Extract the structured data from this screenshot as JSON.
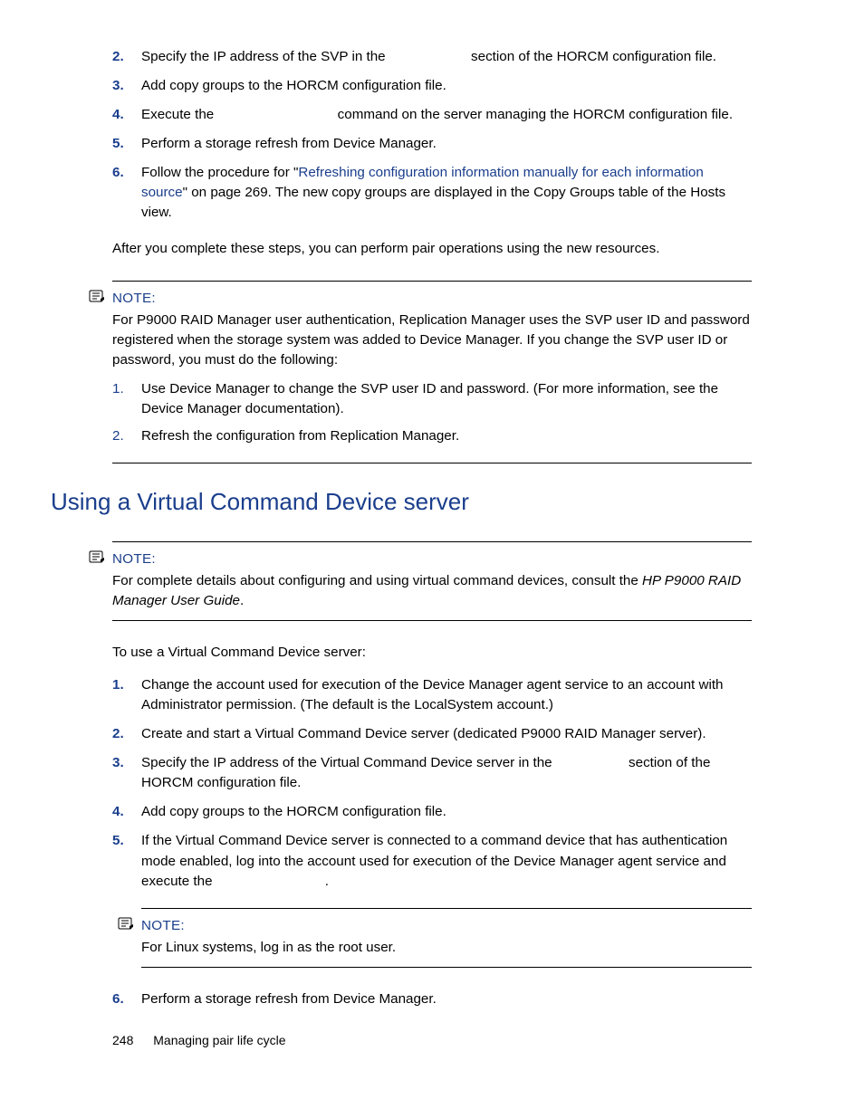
{
  "steps_top": [
    {
      "n": "2.",
      "text_before": "Specify the IP address of the SVP in the ",
      "code": "",
      "text_after": " section of the HORCM configuration file."
    },
    {
      "n": "3.",
      "text": "Add copy groups to the HORCM configuration file."
    },
    {
      "n": "4.",
      "text_before": "Execute the ",
      "code": "",
      "text_after": " command on the server managing the HORCM configuration file."
    },
    {
      "n": "5.",
      "text": "Perform a storage refresh from Device Manager."
    },
    {
      "n": "6.",
      "text_before": "Follow the procedure for \"",
      "link": "Refreshing configuration information manually for each information source",
      "text_after": "\" on page 269. The new copy groups are displayed in the Copy Groups table of the Hosts view."
    }
  ],
  "after_steps": "After you complete these steps, you can perform pair operations using the new resources.",
  "note1": {
    "label": "NOTE:",
    "text": "For P9000 RAID Manager user authentication, Replication Manager uses the SVP user ID and password registered when the storage system was added to Device Manager. If you change the SVP user ID or password, you must do the following:",
    "subs": [
      {
        "n": "1.",
        "text": "Use Device Manager to change the SVP user ID and password. (For more information, see the Device Manager documentation)."
      },
      {
        "n": "2.",
        "text": "Refresh the configuration from Replication Manager."
      }
    ]
  },
  "section_title": "Using a Virtual Command Device server",
  "note2": {
    "label": "NOTE:",
    "text_before": "For complete details about configuring and using virtual command devices, consult the ",
    "italic": "HP P9000 RAID Manager User Guide",
    "text_after": "."
  },
  "lead": "To use a Virtual Command Device server:",
  "steps_bottom": [
    {
      "n": "1.",
      "text": "Change the account used for execution of the Device Manager agent service to an account with Administrator permission. (The default is the LocalSystem account.)"
    },
    {
      "n": "2.",
      "text": "Create and start a Virtual Command Device server (dedicated P9000 RAID Manager server)."
    },
    {
      "n": "3.",
      "text_before": "Specify the IP address of the Virtual Command Device server in the ",
      "code": "",
      "text_after": " section of the HORCM configuration file."
    },
    {
      "n": "4.",
      "text": "Add copy groups to the HORCM configuration file."
    },
    {
      "n": "5.",
      "text_before": "If the Virtual Command Device server is connected to a command device that has authentication mode enabled, log into the account used for execution of the Device Manager agent service and execute the ",
      "code": "",
      "text_after": "."
    }
  ],
  "note3": {
    "label": "NOTE:",
    "text": "For Linux systems, log in as the root user."
  },
  "step6": {
    "n": "6.",
    "text": "Perform a storage refresh from Device Manager."
  },
  "footer": {
    "page": "248",
    "title": "Managing pair life cycle"
  }
}
